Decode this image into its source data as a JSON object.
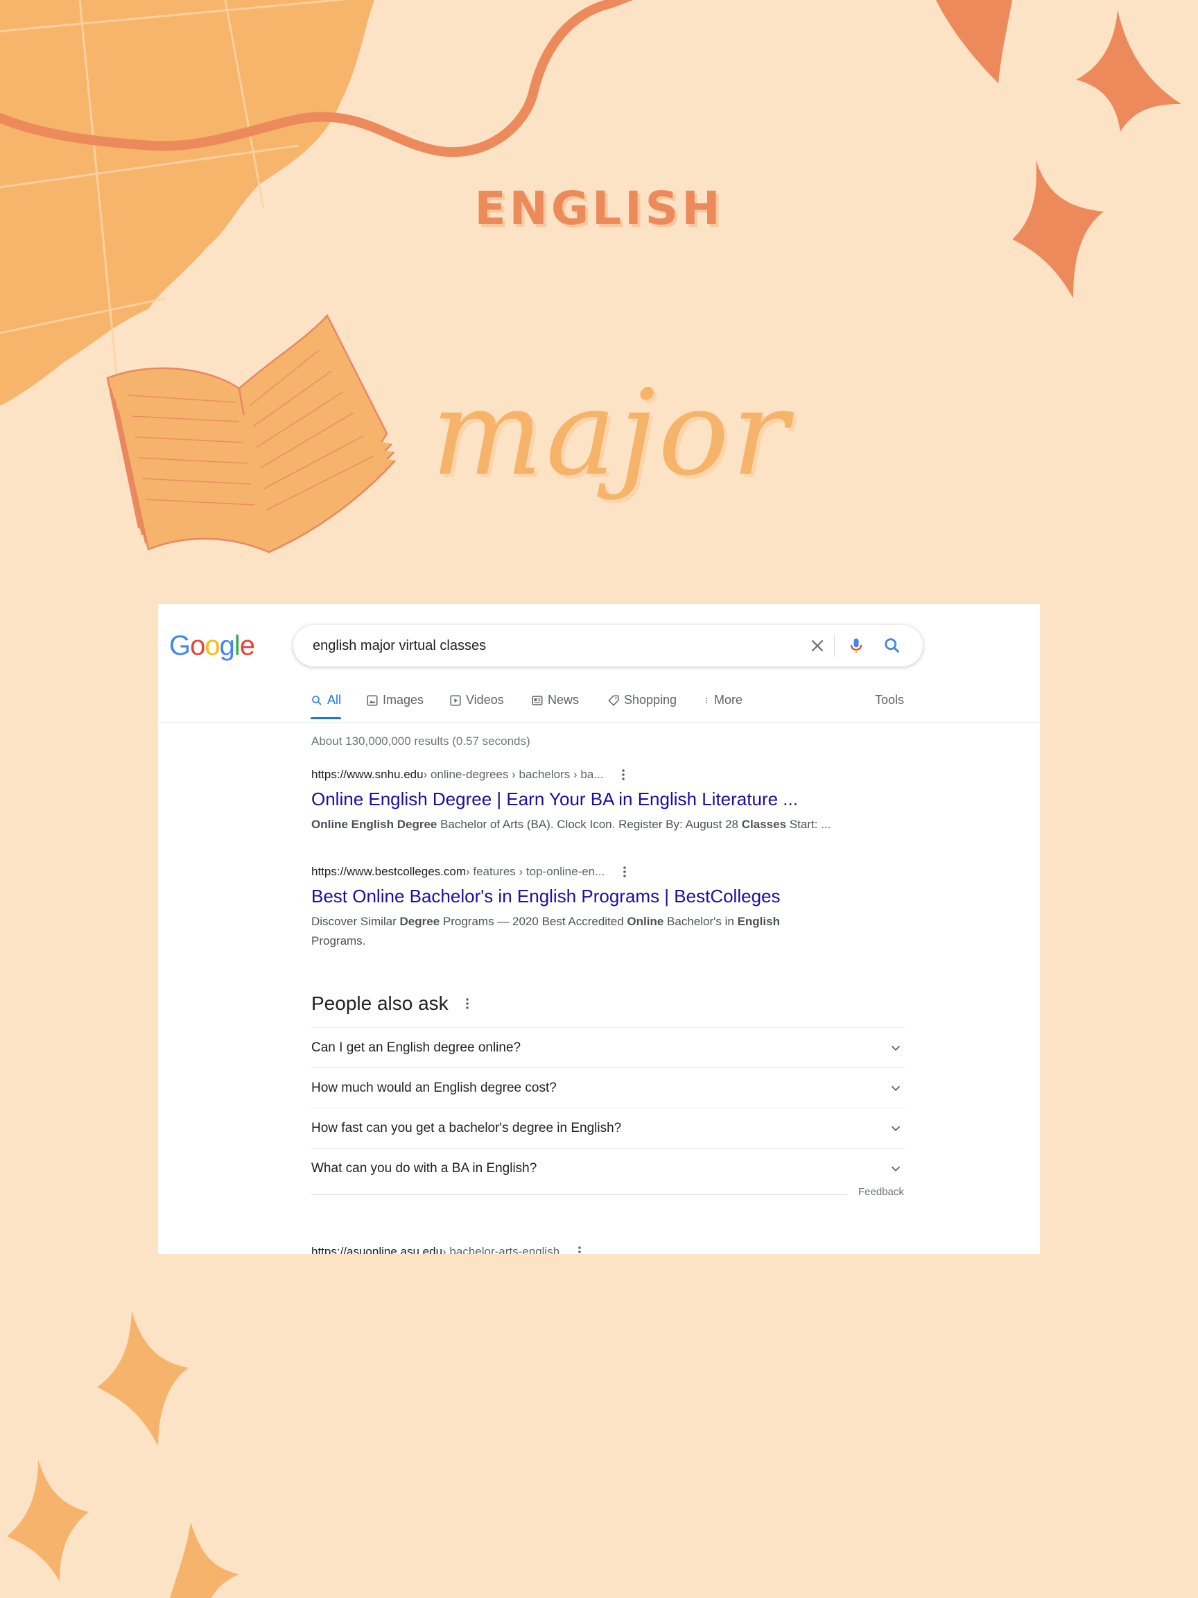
{
  "poster": {
    "heading": "ENGLISH",
    "script": "major"
  },
  "google": {
    "logo": [
      "G",
      "o",
      "o",
      "g",
      "l",
      "e"
    ],
    "logo_colors": [
      "#4285F4",
      "#EA4335",
      "#FBBC05",
      "#4285F4",
      "#34A853",
      "#EA4335"
    ],
    "search": {
      "value": "english major virtual classes"
    },
    "tabs": [
      {
        "label": "All",
        "icon": "search-icon",
        "active": true
      },
      {
        "label": "Images",
        "icon": "image-icon"
      },
      {
        "label": "Videos",
        "icon": "play-icon"
      },
      {
        "label": "News",
        "icon": "news-icon"
      },
      {
        "label": "Shopping",
        "icon": "tag-icon"
      },
      {
        "label": "More",
        "icon": "more-vertical-icon"
      }
    ],
    "tools_label": "Tools",
    "stats": "About 130,000,000 results (0.57 seconds)",
    "results": [
      {
        "url_domain": "https://www.snhu.edu",
        "url_path": " › online-degrees › bachelors › ba...",
        "title": "Online English Degree | Earn Your BA in English Literature ...",
        "snippet_parts": [
          {
            "t": "Online English Degree",
            "b": true
          },
          {
            "t": " Bachelor of Arts (BA). Clock Icon. Register By: August 28 ",
            "b": false
          },
          {
            "t": "Classes",
            "b": true
          },
          {
            "t": " Start: ...",
            "b": false
          }
        ]
      },
      {
        "url_domain": "https://www.bestcolleges.com",
        "url_path": " › features › top-online-en...",
        "title": "Best Online Bachelor's in English Programs | BestColleges",
        "snippet_parts": [
          {
            "t": "Discover Similar ",
            "b": false
          },
          {
            "t": "Degree",
            "b": true
          },
          {
            "t": " Programs — 2020 Best Accredited ",
            "b": false
          },
          {
            "t": "Online",
            "b": true
          },
          {
            "t": " Bachelor's in ",
            "b": false
          },
          {
            "t": "English",
            "b": true
          },
          {
            "t": " Programs.",
            "b": false
          }
        ]
      }
    ],
    "people_also_ask": {
      "heading": "People also ask",
      "questions": [
        "Can I get an English degree online?",
        "How much would an English degree cost?",
        "How fast can you get a bachelor's degree in English?",
        "What can you do with a BA in English?"
      ]
    },
    "feedback_label": "Feedback",
    "cutoff_result": {
      "url_domain": "https://asuonline.asu.edu",
      "url_path": " › bachelor-arts-english"
    }
  },
  "colors": {
    "background": "#fde3c6",
    "accent_orange": "#ec8a5c",
    "accent_light": "#f6b46a",
    "link_blue": "#1a0dab",
    "google_blue": "#1a73e8"
  }
}
